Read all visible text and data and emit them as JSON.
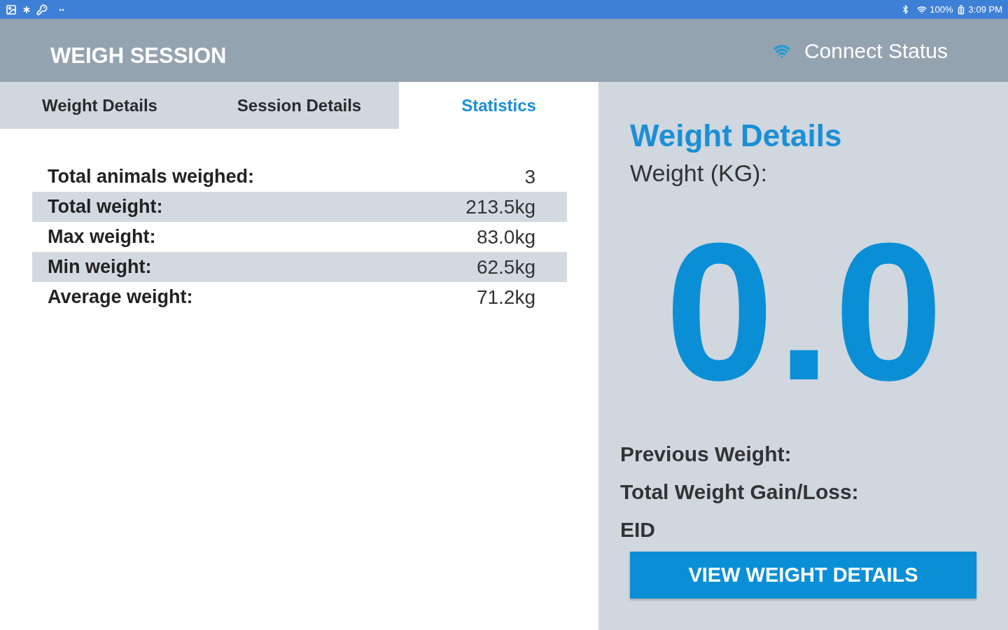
{
  "status_bar": {
    "battery": "100%",
    "time": "3:09 PM"
  },
  "header": {
    "title": "WEIGH SESSION",
    "connect_status": "Connect Status"
  },
  "tabs": [
    {
      "label": "Weight Details",
      "selected": false
    },
    {
      "label": "Session Details",
      "selected": false
    },
    {
      "label": "Statistics",
      "selected": true
    }
  ],
  "statistics": [
    {
      "label": "Total animals weighed:",
      "value": "3"
    },
    {
      "label": "Total weight:",
      "value": "213.5kg"
    },
    {
      "label": "Max weight:",
      "value": "83.0kg"
    },
    {
      "label": "Min weight:",
      "value": "62.5kg"
    },
    {
      "label": "Average weight:",
      "value": "71.2kg"
    }
  ],
  "weight_panel": {
    "title": "Weight Details",
    "unit_label": "Weight (KG):",
    "reading": "0.0",
    "fields": [
      "Previous Weight:",
      "Total Weight Gain/Loss:",
      "EID"
    ],
    "button": "VIEW WEIGHT DETAILS"
  }
}
